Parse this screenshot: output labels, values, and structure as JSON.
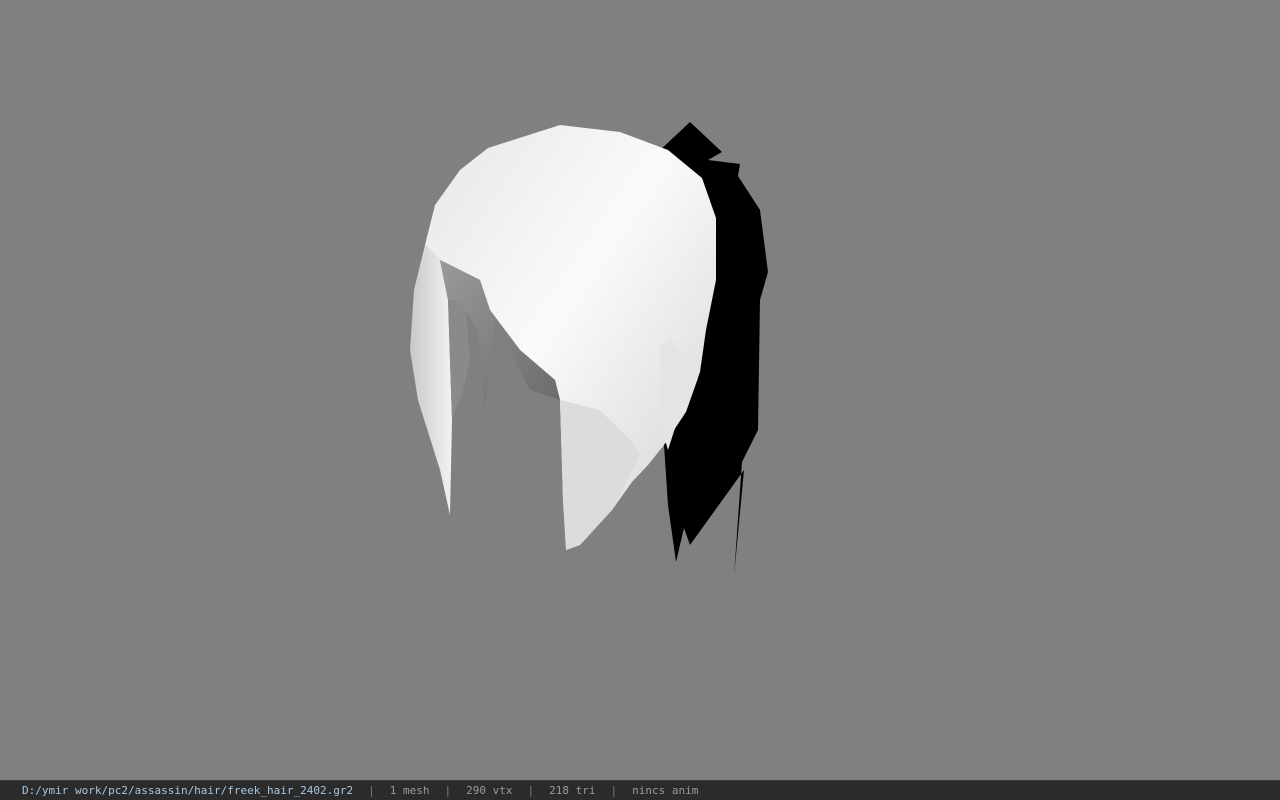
{
  "viewport": {
    "background_color": "#808080",
    "model": "freek_hair_2402"
  },
  "status_bar": {
    "file_path": "D:/ymir work/pc2/assassin/hair/freek_hair_2402.gr2",
    "separator": "|",
    "mesh_count": "1 mesh",
    "vertex_count": "290 vtx",
    "triangle_count": "218 tri",
    "anim_status": "nincs anim",
    "background_color": "#2b2b2b",
    "path_color": "#a8c6e0"
  }
}
